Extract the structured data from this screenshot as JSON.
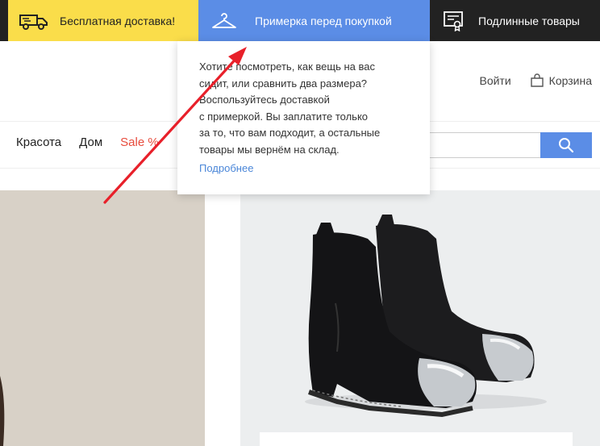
{
  "promo": {
    "delivery_label": "Бесплатная доставка!",
    "fitting_label": "Примерка перед покупкой",
    "authentic_label": "Подлинные товары"
  },
  "header": {
    "login_label": "Войти",
    "cart_label": "Корзина"
  },
  "nav": {
    "items": [
      "Красота",
      "Дом",
      "Sale %"
    ]
  },
  "tooltip": {
    "text": "Хотите посмотреть, как вещь на вас\nсидит, или сравнить два размера?\nВоспользуйтесь доставкой\nс примеркой. Вы заплатите только\nза то, что вам подходит, а остальные\nтовары мы вернём на склад.",
    "link_label": "Подробнее"
  },
  "colors": {
    "promo_yellow": "#fadd4a",
    "promo_blue": "#5b8de6",
    "promo_dark": "#222222",
    "sale_red": "#e74b3c",
    "link_blue": "#4a86d8",
    "annotation_arrow": "#e8202a"
  },
  "icons": [
    "delivery-truck-icon",
    "clothes-hanger-icon",
    "certificate-icon",
    "shopping-bag-icon",
    "search-icon"
  ]
}
